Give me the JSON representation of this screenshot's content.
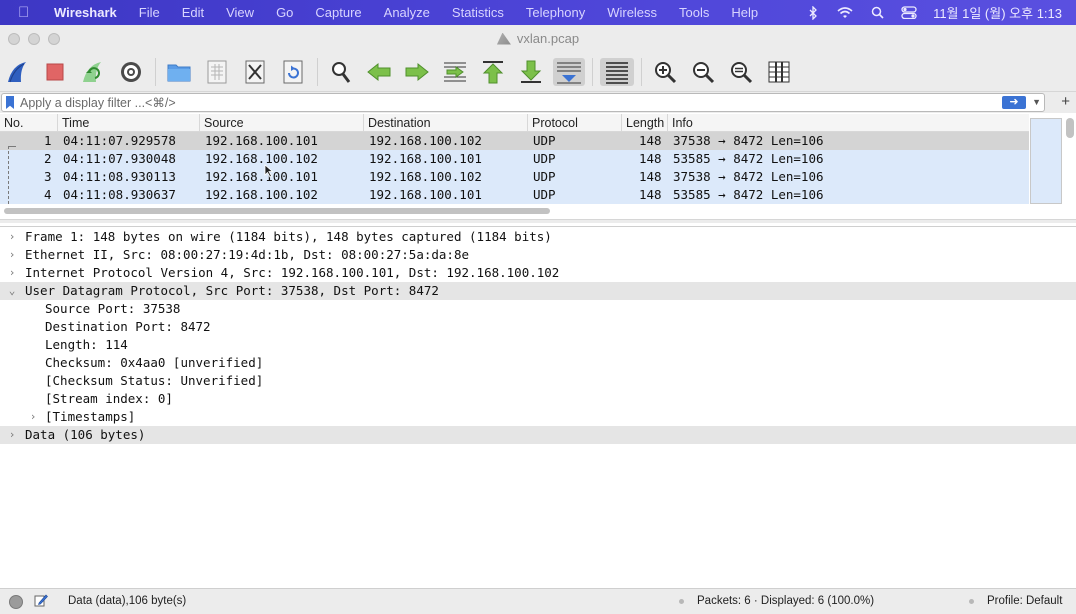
{
  "menubar": {
    "app": "Wireshark",
    "items": [
      "File",
      "Edit",
      "View",
      "Go",
      "Capture",
      "Analyze",
      "Statistics",
      "Telephony",
      "Wireless",
      "Tools",
      "Help"
    ],
    "clock": "11월 1일 (월) 오후 1:13",
    "status_icons": [
      "bluetooth-icon",
      "wifi-icon",
      "spotlight-search-icon",
      "control-center-icon"
    ]
  },
  "window": {
    "title": "vxlan.pcap"
  },
  "toolbar": {
    "buttons": [
      "start-capture",
      "stop-capture",
      "restart-capture",
      "capture-options",
      "open-file",
      "save-file",
      "close-file",
      "reload-file",
      "find-packet",
      "go-back",
      "go-forward",
      "go-to-packet",
      "first-packet",
      "last-packet",
      "auto-scroll",
      "colorize",
      "zoom-in",
      "zoom-out",
      "normal-size",
      "resize-columns"
    ]
  },
  "filter": {
    "placeholder": "Apply a display filter ...<⌘/>"
  },
  "packet_list": {
    "columns": [
      "No.",
      "Time",
      "Source",
      "Destination",
      "Protocol",
      "Length",
      "Info"
    ],
    "rows": [
      {
        "no": "1",
        "time": "04:11:07.929578",
        "src": "192.168.100.101",
        "dst": "192.168.100.102",
        "proto": "UDP",
        "len": "148",
        "info": "37538 → 8472 Len=106"
      },
      {
        "no": "2",
        "time": "04:11:07.930048",
        "src": "192.168.100.102",
        "dst": "192.168.100.101",
        "proto": "UDP",
        "len": "148",
        "info": "53585 → 8472 Len=106"
      },
      {
        "no": "3",
        "time": "04:11:08.930113",
        "src": "192.168.100.101",
        "dst": "192.168.100.102",
        "proto": "UDP",
        "len": "148",
        "info": "37538 → 8472 Len=106"
      },
      {
        "no": "4",
        "time": "04:11:08.930637",
        "src": "192.168.100.102",
        "dst": "192.168.100.101",
        "proto": "UDP",
        "len": "148",
        "info": "53585 → 8472 Len=106"
      }
    ],
    "selected_row": 1
  },
  "details": {
    "items": [
      {
        "text": "Frame 1: 148 bytes on wire (1184 bits), 148 bytes captured (1184 bits)",
        "arrow": "›",
        "indent": 0,
        "highlight": false
      },
      {
        "text": "Ethernet II, Src: 08:00:27:19:4d:1b, Dst: 08:00:27:5a:da:8e",
        "arrow": "›",
        "indent": 0,
        "highlight": false
      },
      {
        "text": "Internet Protocol Version 4, Src: 192.168.100.101, Dst: 192.168.100.102",
        "arrow": "›",
        "indent": 0,
        "highlight": false
      },
      {
        "text": "User Datagram Protocol, Src Port: 37538, Dst Port: 8472",
        "arrow": "⌄",
        "indent": 0,
        "highlight": true
      },
      {
        "text": "Source Port: 37538",
        "arrow": "",
        "indent": 1,
        "highlight": false
      },
      {
        "text": "Destination Port: 8472",
        "arrow": "",
        "indent": 1,
        "highlight": false
      },
      {
        "text": "Length: 114",
        "arrow": "",
        "indent": 1,
        "highlight": false
      },
      {
        "text": "Checksum: 0x4aa0 [unverified]",
        "arrow": "",
        "indent": 1,
        "highlight": false
      },
      {
        "text": "[Checksum Status: Unverified]",
        "arrow": "",
        "indent": 1,
        "highlight": false
      },
      {
        "text": "[Stream index: 0]",
        "arrow": "",
        "indent": 1,
        "highlight": false
      },
      {
        "text": "[Timestamps]",
        "arrow": "›",
        "indent": 1,
        "highlight": false
      },
      {
        "text": "Data (106 bytes)",
        "arrow": "›",
        "indent": 0,
        "highlight": true
      }
    ]
  },
  "statusbar": {
    "field_info": "Data (data),106 byte(s)",
    "packets": "Packets: 6 · Displayed: 6 (100.0%)",
    "profile": "Profile: Default"
  }
}
